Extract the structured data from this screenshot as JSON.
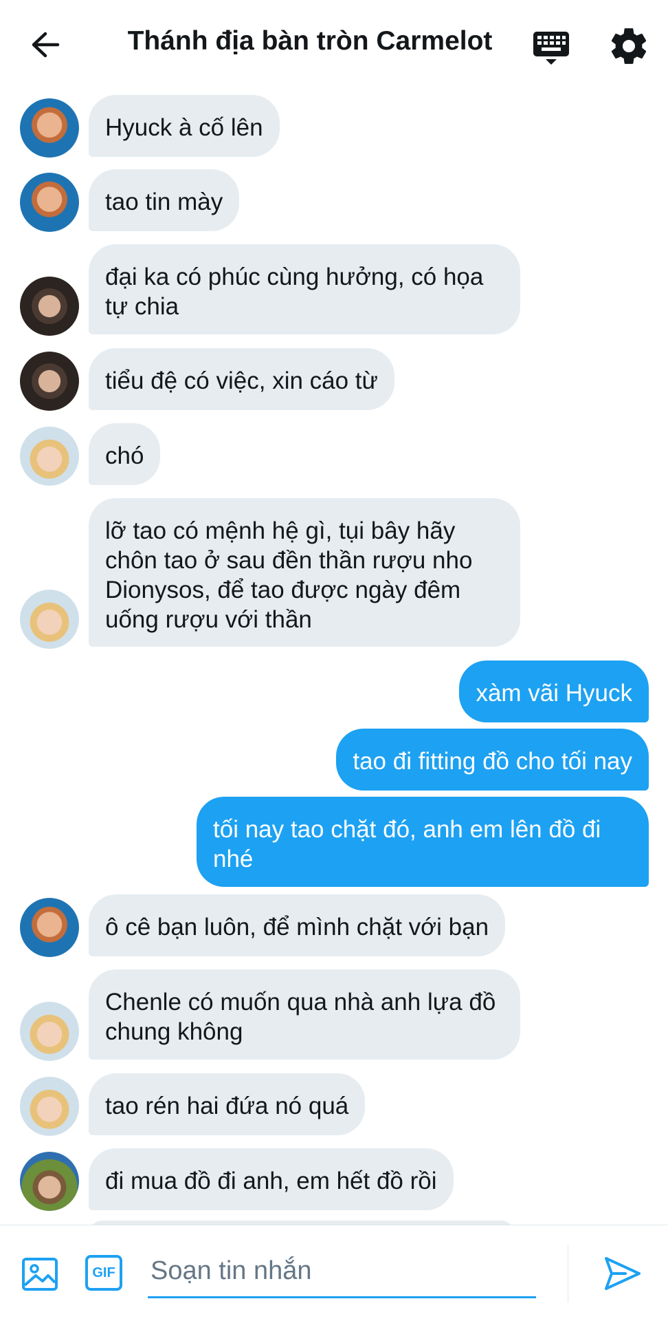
{
  "header": {
    "title": "Thánh địa bàn tròn Carmelot",
    "back_icon": "arrow-left-icon",
    "keyboard_icon": "keyboard-icon",
    "settings_icon": "gear-icon"
  },
  "messages": [
    {
      "direction": "in",
      "text": "Hyuck à cố lên"
    },
    {
      "direction": "in",
      "text": "tao tin mày"
    },
    {
      "direction": "in",
      "text": "đại ka có phúc cùng hưởng, có họa tự chia"
    },
    {
      "direction": "in",
      "text": "tiểu đệ có việc, xin cáo từ"
    },
    {
      "direction": "in",
      "text": "chó"
    },
    {
      "direction": "in",
      "text": "lỡ tao có mệnh hệ gì, tụi bây hãy chôn tao ở sau đền thần rượu nho Dionysos, để tao được ngày đêm uống rượu với thần"
    },
    {
      "direction": "out",
      "text": "xàm vãi Hyuck"
    },
    {
      "direction": "out",
      "text": "tao đi fitting đồ cho tối nay"
    },
    {
      "direction": "out",
      "text": "tối nay tao chặt đó, anh em lên đồ đi nhé"
    },
    {
      "direction": "in",
      "text": "ô cê bạn luôn, để mình chặt với bạn"
    },
    {
      "direction": "in",
      "text": "Chenle có muốn qua nhà anh lựa đồ chung không"
    },
    {
      "direction": "in",
      "text": "tao rén hai đứa nó quá"
    },
    {
      "direction": "in",
      "text": "đi mua đồ đi anh, em hết đồ rồi"
    }
  ],
  "composer": {
    "placeholder": "Soạn tin nhắn",
    "gif_label": "GIF",
    "image_icon": "image-icon",
    "send_icon": "send-icon"
  },
  "colors": {
    "accent": "#1da1f2",
    "incoming_bubble": "#e6ecf0",
    "text": "#14171a"
  }
}
